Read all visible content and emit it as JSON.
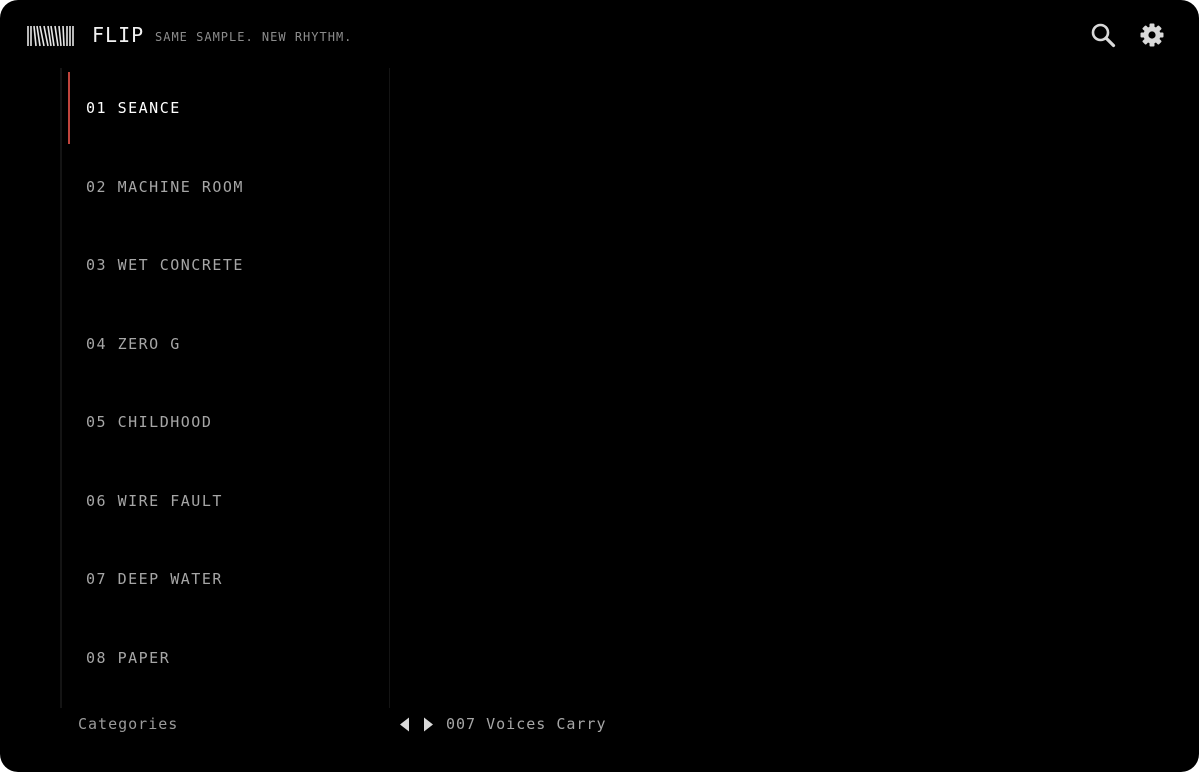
{
  "header": {
    "brand": "FLIP",
    "tagline": "SAME SAMPLE. NEW RHYTHM.",
    "icons": {
      "logo": "waveform-stripes-icon",
      "search": "search-icon",
      "settings": "gear-icon"
    }
  },
  "sidebar": {
    "items": [
      {
        "label": "01 SEANCE",
        "active": true
      },
      {
        "label": "02 MACHINE ROOM",
        "active": false
      },
      {
        "label": "03 WET CONCRETE",
        "active": false
      },
      {
        "label": "04 ZERO G",
        "active": false
      },
      {
        "label": "05 CHILDHOOD",
        "active": false
      },
      {
        "label": "06 WIRE FAULT",
        "active": false
      },
      {
        "label": "07 DEEP WATER",
        "active": false
      },
      {
        "label": "08 PAPER",
        "active": false
      }
    ],
    "footer_title": "Categories"
  },
  "player": {
    "track": "007 Voices Carry",
    "icons": {
      "prev": "triangle-left-icon",
      "next": "triangle-right-icon"
    }
  },
  "colors": {
    "background": "#000000",
    "accent": "#c0443c",
    "text_active": "#ffffff",
    "text_muted": "#a6a6a6"
  }
}
